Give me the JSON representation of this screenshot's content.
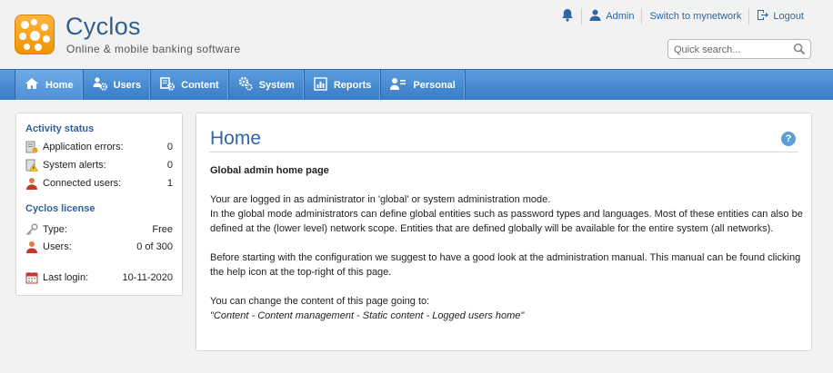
{
  "app": {
    "title": "Cyclos",
    "subtitle": "Online & mobile banking software"
  },
  "top_links": {
    "user": "Admin",
    "switch": "Switch to mynetwork",
    "logout": "Logout"
  },
  "search": {
    "placeholder": "Quick search..."
  },
  "nav": {
    "items": [
      {
        "label": "Home",
        "icon": "home-icon"
      },
      {
        "label": "Users",
        "icon": "users-gear-icon"
      },
      {
        "label": "Content",
        "icon": "content-gear-icon"
      },
      {
        "label": "System",
        "icon": "system-gear-icon"
      },
      {
        "label": "Reports",
        "icon": "reports-icon"
      },
      {
        "label": "Personal",
        "icon": "personal-icon"
      }
    ]
  },
  "sidebar": {
    "activity_title": "Activity status",
    "activity": [
      {
        "label": "Application errors:",
        "value": "0",
        "icon": "application-errors-icon"
      },
      {
        "label": "System alerts:",
        "value": "0",
        "icon": "alert-icon"
      },
      {
        "label": "Connected users:",
        "value": "1",
        "icon": "user-icon"
      }
    ],
    "license_title": "Cyclos license",
    "license": [
      {
        "label": "Type:",
        "value": "Free",
        "icon": "key-icon"
      },
      {
        "label": "Users:",
        "value": "0 of 300",
        "icon": "user-icon"
      }
    ],
    "last_login": {
      "label": "Last login:",
      "value": "10-11-2020",
      "icon": "calendar-icon"
    }
  },
  "main": {
    "title": "Home",
    "heading": "Global admin home page",
    "p1_line1": "Your are logged in as administrator in 'global' or system administration mode.",
    "p1_line2": "In the global mode administrators can define global entities such as password types and languages. Most of these entities can also be defined at the (lower level) network scope. Entities that are defined globally will be available for the entire system (all networks).",
    "p2": "Before starting with the configuration we suggest to have a good look at the administration manual. This manual can be found clicking the help icon at the top-right of this page.",
    "p3": "You can change the content of this page going to:",
    "p3_path": "\"Content - Content management - Static content - Logged users home\""
  },
  "colors": {
    "brand_blue": "#2e5f8f",
    "nav_blue": "#3a7cc7",
    "logo_orange": "#f39200"
  }
}
